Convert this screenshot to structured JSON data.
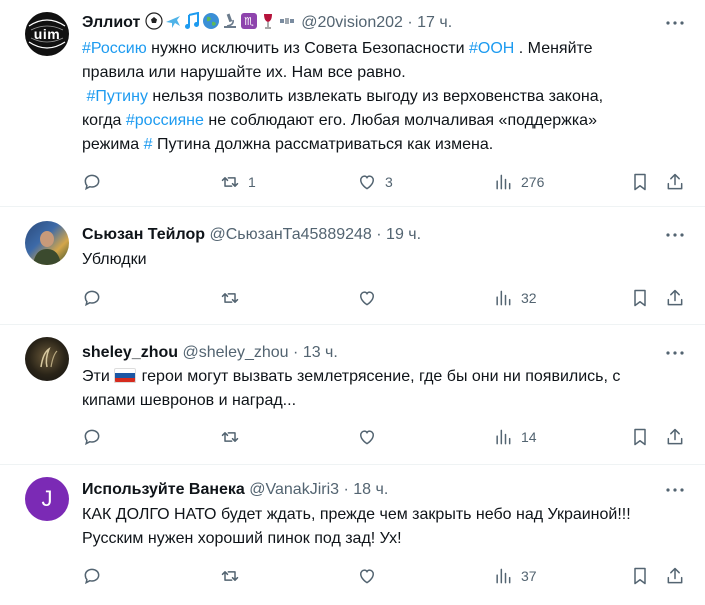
{
  "tweets": [
    {
      "name": "Эллиот",
      "handle": "@20vision202",
      "sep": "·",
      "time": "17 ч.",
      "lines": [
        [
          {
            "t": "#Россию",
            "h": true
          },
          {
            "t": " нужно исключить из Совета Безопасности ",
            "h": false
          },
          {
            "t": "#ООН",
            "h": true
          },
          {
            "t": " . Меняйте",
            "h": false
          }
        ],
        [
          {
            "t": "правила или нарушайте их. Нам все равно.",
            "h": false
          }
        ],
        [
          {
            "t": " ",
            "h": false
          },
          {
            "t": "#Путину",
            "h": true
          },
          {
            "t": " нельзя позволить извлекать выгоду из верховенства закона,",
            "h": false
          }
        ],
        [
          {
            "t": "когда ",
            "h": false
          },
          {
            "t": "#россияне",
            "h": true
          },
          {
            "t": " не соблюдают его. Любая молчаливая «поддержка»",
            "h": false
          }
        ],
        [
          {
            "t": "режима ",
            "h": false
          },
          {
            "t": "#",
            "h": true
          },
          {
            "t": " Путина должна рассматриваться как измена.",
            "h": false
          }
        ]
      ],
      "reply_count": "",
      "retweet_count": "1",
      "like_count": "3",
      "view_count": "276",
      "avatar_text": "uim"
    },
    {
      "name": "Сьюзан Тейлор",
      "handle": "@СьюзанТа45889248",
      "sep": "·",
      "time": "19 ч.",
      "lines": [
        [
          {
            "t": "Ублюдки",
            "h": false
          }
        ]
      ],
      "reply_count": "",
      "retweet_count": "",
      "like_count": "",
      "view_count": "32"
    },
    {
      "name": "sheley_zhou",
      "handle": "@sheley_zhou",
      "sep": "·",
      "time": "13 ч.",
      "lines": [
        [
          {
            "t": "Эти ",
            "h": false
          },
          {
            "flag": true
          },
          {
            "t": " герои могут вызвать землетрясение, где бы они ни появились, с",
            "h": false
          }
        ],
        [
          {
            "t": "кипами шевронов и наград...",
            "h": false
          }
        ]
      ],
      "reply_count": "",
      "retweet_count": "",
      "like_count": "",
      "view_count": "14"
    },
    {
      "name": "Используйте Ванека",
      "handle": "@VanakJiri3",
      "sep": "·",
      "time": "18 ч.",
      "lines": [
        [
          {
            "t": "КАК ДОЛГО НАТО будет ждать, прежде чем закрыть небо над Украиной!!!",
            "h": false
          }
        ],
        [
          {
            "t": "Русским нужен хороший пинок под зад! Ух!",
            "h": false
          }
        ]
      ],
      "reply_count": "",
      "retweet_count": "",
      "like_count": "",
      "view_count": "37",
      "avatar_text": "J"
    }
  ],
  "icons": {
    "name_emojis": [
      "soccer-ball-icon",
      "airplane-icon",
      "music-notes-icon",
      "globe-icon",
      "microscope-icon",
      "scorpio-icon",
      "wine-glass-icon",
      "satellite-icon"
    ]
  },
  "colors": {
    "hashtag": "#1d9bf0",
    "text": "#0f1419",
    "secondary": "#536471",
    "avatar_purple": "#7b2ab5",
    "divider": "#eff3f4"
  }
}
